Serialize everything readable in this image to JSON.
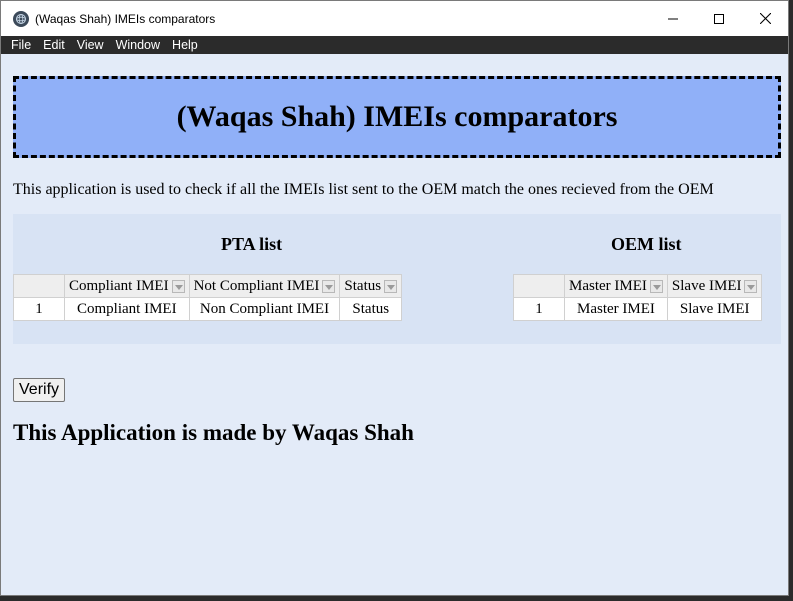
{
  "window": {
    "title": "(Waqas Shah) IMEIs comparators",
    "controls": {
      "minimize": "minimize-icon",
      "maximize": "maximize-icon",
      "close": "close-icon"
    }
  },
  "menu": [
    "File",
    "Edit",
    "View",
    "Window",
    "Help"
  ],
  "header": {
    "title": "(Waqas Shah) IMEIs comparators"
  },
  "description": "This application is used to check if all the IMEIs list sent to the OEM match the ones recieved from the OEM",
  "pta": {
    "title": "PTA list",
    "columns": [
      "Compliant IMEI",
      "Not Compliant IMEI",
      "Status"
    ],
    "rows": [
      {
        "index": "1",
        "cells": [
          "Compliant IMEI",
          "Non Compliant IMEI",
          "Status"
        ]
      }
    ]
  },
  "oem": {
    "title": "OEM list",
    "columns": [
      "Master IMEI",
      "Slave IMEI"
    ],
    "rows": [
      {
        "index": "1",
        "cells": [
          "Master IMEI",
          "Slave IMEI"
        ]
      }
    ]
  },
  "verify_label": "Verify",
  "footer": "This Application is made by Waqas Shah",
  "colors": {
    "header_bg": "#90b0f8",
    "page_bg": "#e3ebf8",
    "lists_bg": "#d8e3f4",
    "menubar_bg": "#2b2b2b"
  }
}
